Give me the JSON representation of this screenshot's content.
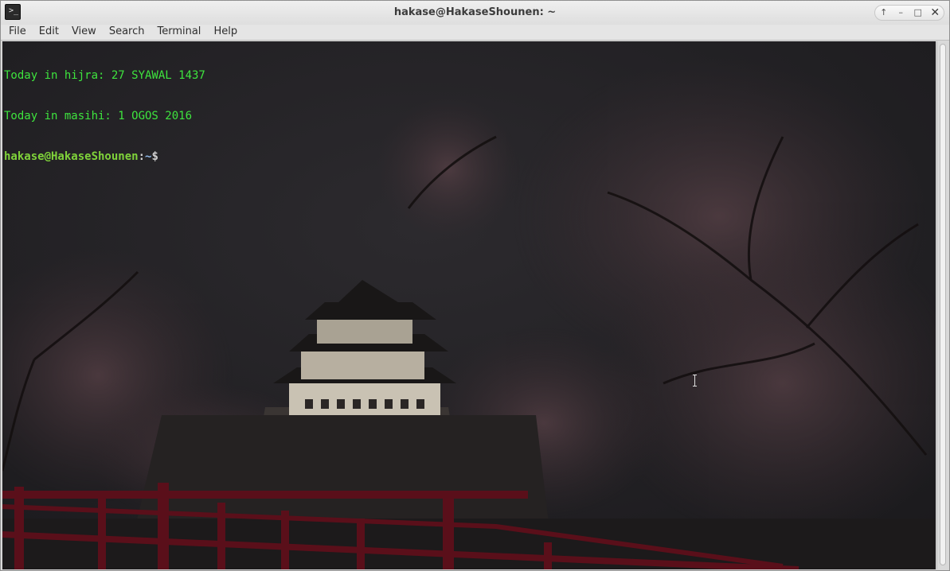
{
  "window": {
    "title": "hakase@HakaseShounen: ~",
    "app_icon": "terminal-icon",
    "controls": [
      "up-arrow-icon",
      "minimize-icon",
      "maximize-icon",
      "close-icon"
    ],
    "control_glyphs": {
      "up": "↑",
      "min": "–",
      "max": "□",
      "close": "✕"
    }
  },
  "menubar": {
    "items": [
      "File",
      "Edit",
      "View",
      "Search",
      "Terminal",
      "Help"
    ]
  },
  "terminal": {
    "lines": [
      "Today in hijra: 27 SYAWAL 1437",
      "Today in masihi: 1 OGOS 2016"
    ],
    "prompt": {
      "user_host": "hakase@HakaseShounen",
      "colon": ":",
      "path": "~",
      "symbol": "$"
    },
    "colors": {
      "output_green": "#3ee43e",
      "prompt_user": "#7fd33a",
      "prompt_path": "#8fb8e8"
    },
    "background": "night castle with cherry blossoms and red bridge (dimmed wallpaper)"
  }
}
